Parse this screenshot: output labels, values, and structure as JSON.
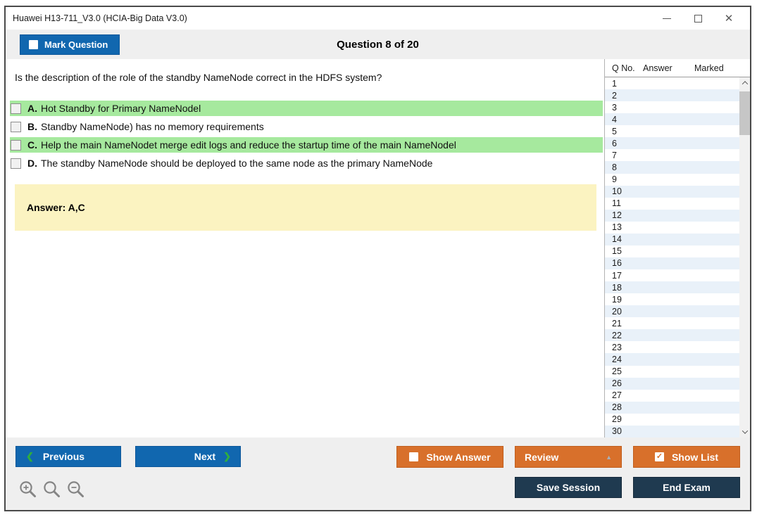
{
  "window": {
    "title": "Huawei H13-711_V3.0 (HCIA-Big Data V3.0)"
  },
  "icons": {
    "minimize": "css-line",
    "maximize": "css-square",
    "close": "✕",
    "prev_chevron": "❮",
    "next_chevron": "❯",
    "review_caret": "▲",
    "check": "✓",
    "zoom_in": "magnifier-plus",
    "zoom_reset": "magnifier",
    "zoom_out": "magnifier-minus"
  },
  "header": {
    "mark_question": "Mark Question",
    "counter": "Question 8 of 20"
  },
  "question": {
    "text": "Is the description of the role of the standby NameNode correct in the HDFS system?",
    "options": [
      {
        "letter": "A.",
        "text": "Hot Standby for Primary NameNodel",
        "highlighted": true,
        "checked": false
      },
      {
        "letter": "B.",
        "text": "Standby NameNode) has no memory requirements",
        "highlighted": false,
        "checked": false
      },
      {
        "letter": "C.",
        "text": "Help the main NameNodet merge edit logs and reduce the startup time of the main NameNodel",
        "highlighted": true,
        "checked": false
      },
      {
        "letter": "D.",
        "text": "The standby NameNode should be deployed to the same node as the primary NameNode",
        "highlighted": false,
        "checked": false
      }
    ],
    "answer": "Answer: A,C"
  },
  "question_list": {
    "columns": [
      "Q No.",
      "Answer",
      "Marked"
    ],
    "rows": [
      "1",
      "2",
      "3",
      "4",
      "5",
      "6",
      "7",
      "8",
      "9",
      "10",
      "11",
      "12",
      "13",
      "14",
      "15",
      "16",
      "17",
      "18",
      "19",
      "20",
      "21",
      "22",
      "23",
      "24",
      "25",
      "26",
      "27",
      "28",
      "29",
      "30"
    ]
  },
  "footer": {
    "previous": "Previous",
    "next": "Next",
    "show_answer": "Show Answer",
    "review": "Review",
    "show_list": "Show List",
    "save_session": "Save Session",
    "end_exam": "End Exam"
  },
  "colors": {
    "primary_blue": "#1167af",
    "accent_orange": "#d8702b",
    "dark_navy": "#1f3a50",
    "highlight_green": "#a6e99e",
    "answer_yellow": "#fbf3c1",
    "alt_row_blue": "#e9f1f9"
  }
}
